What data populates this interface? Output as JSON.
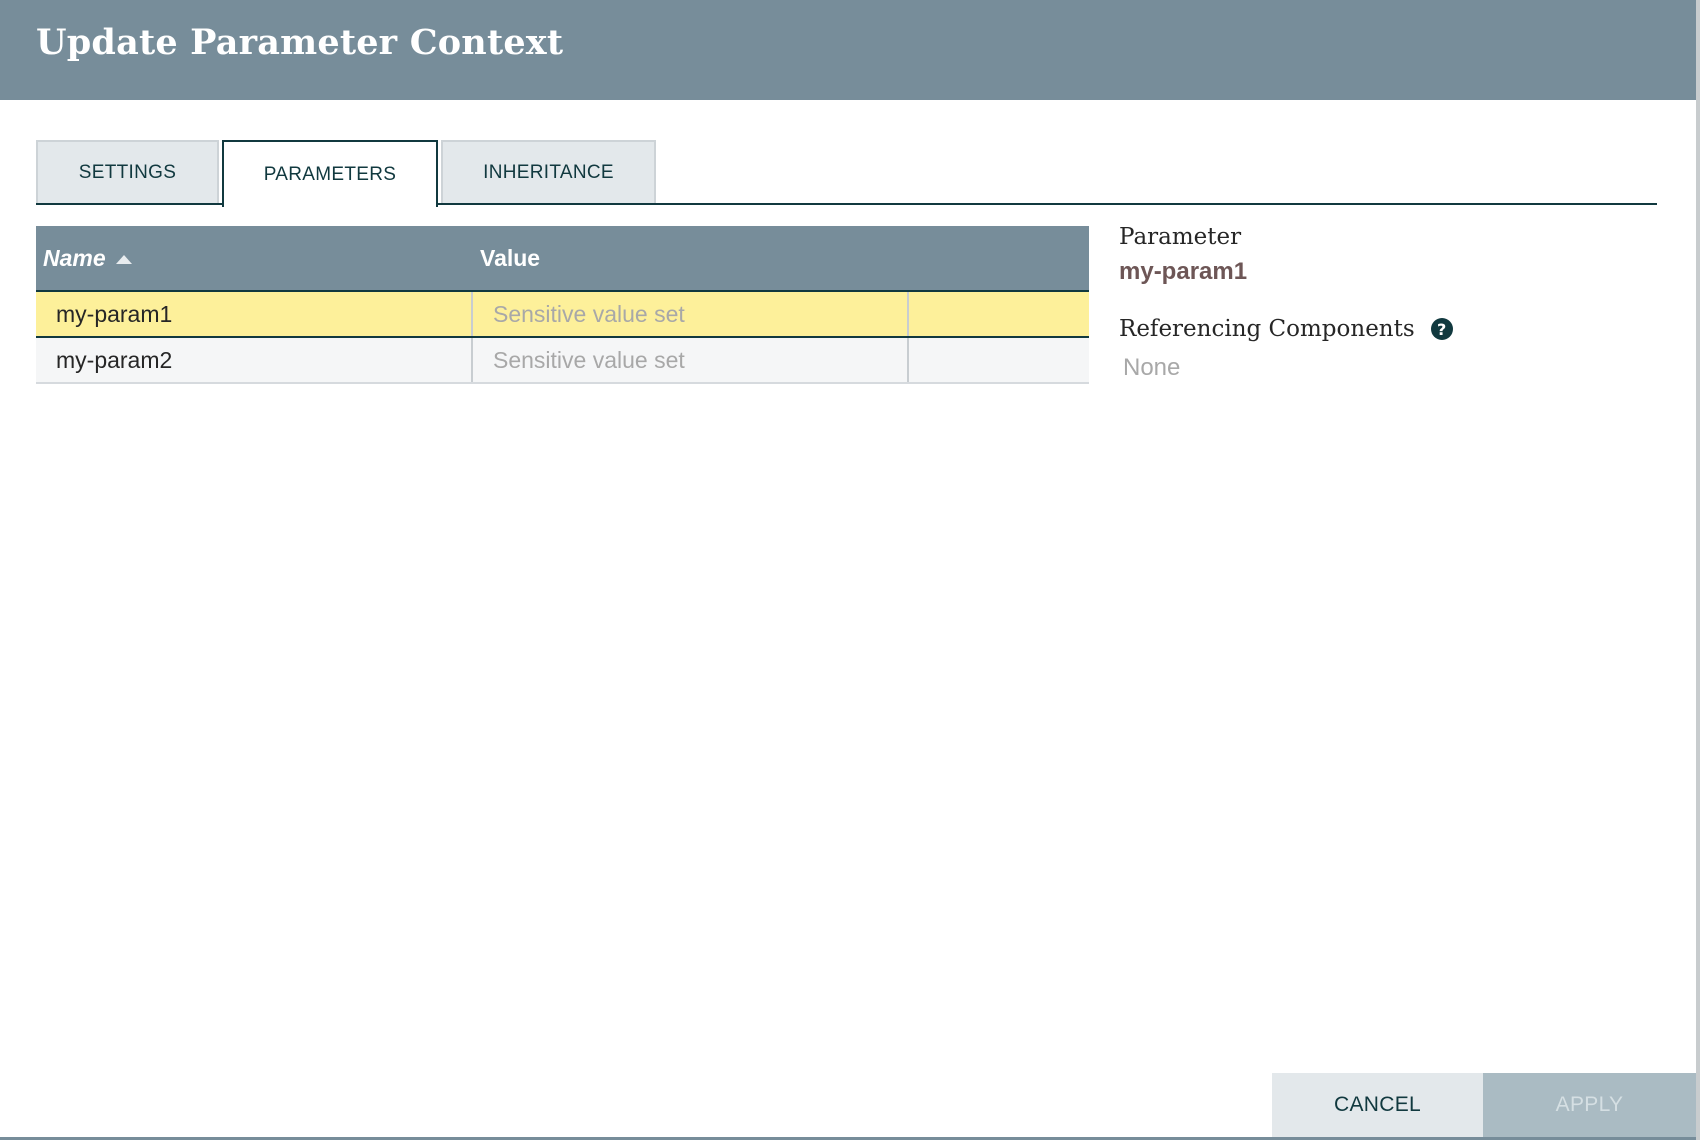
{
  "dialog": {
    "title": "Update Parameter Context"
  },
  "tabs": [
    {
      "label": "SETTINGS",
      "selected": false
    },
    {
      "label": "PARAMETERS",
      "selected": true
    },
    {
      "label": "INHERITANCE",
      "selected": false
    }
  ],
  "table": {
    "columns": {
      "name": "Name",
      "value": "Value"
    },
    "sort": {
      "column": "Name",
      "direction": "ascending"
    },
    "rows": [
      {
        "name": "my-param1",
        "value": "Sensitive value set",
        "selected": true
      },
      {
        "name": "my-param2",
        "value": "Sensitive value set",
        "selected": false
      }
    ]
  },
  "details": {
    "parameter_label": "Parameter",
    "parameter_value": "my-param1",
    "referencing_label": "Referencing Components",
    "referencing_value": "None",
    "help_icon": "question-circle-icon"
  },
  "footer": {
    "cancel_label": "CANCEL",
    "apply_label": "APPLY"
  },
  "colors": {
    "header_bg": "#778d9a",
    "accent": "#11393f",
    "selected_row": "#fdf09a",
    "parameter_name": "#6d5656"
  }
}
